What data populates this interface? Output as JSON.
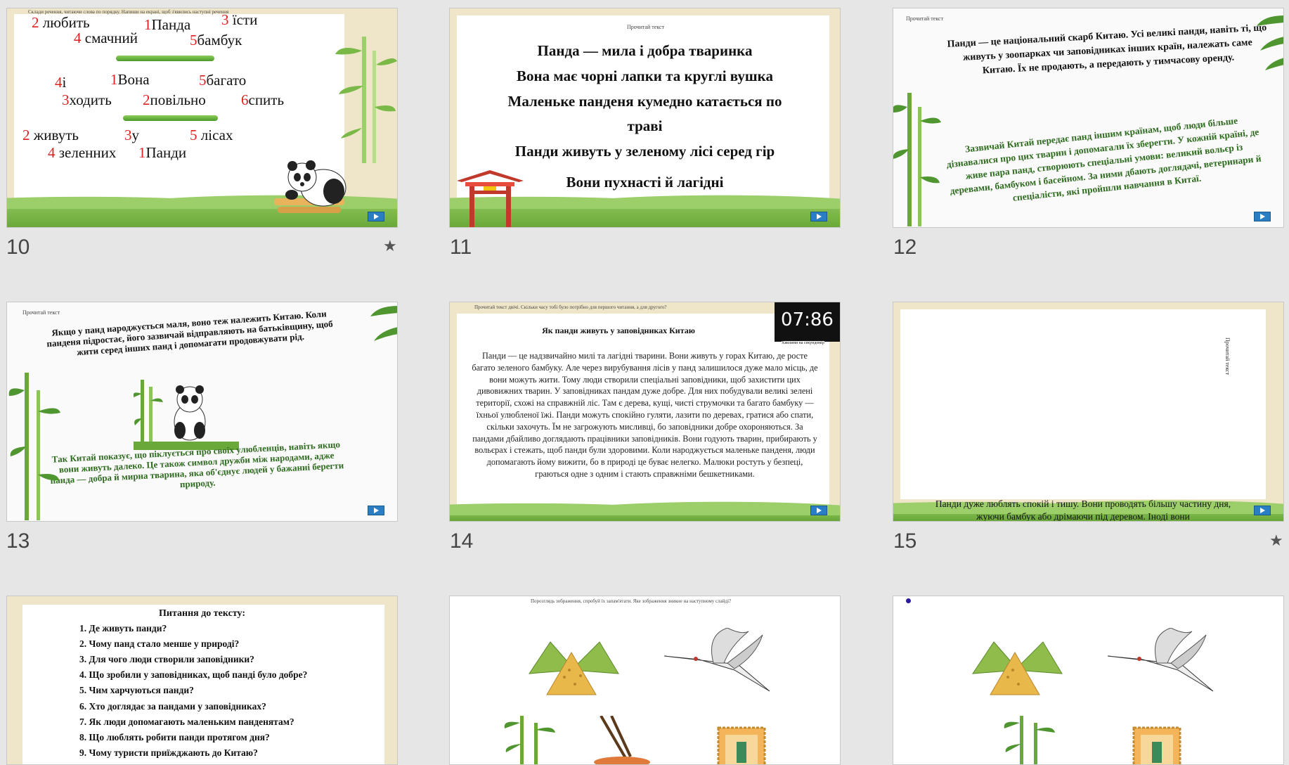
{
  "slides": [
    {
      "num": "10",
      "starred": true,
      "instruction": "Склади речення, читаючи слова по порядку. Напиши на екрані, щоб з'явились наступні речення",
      "words": [
        {
          "n": "2",
          "w": "любить"
        },
        {
          "n": "1",
          "w": "Панда"
        },
        {
          "n": "3",
          "w": "їсти"
        },
        {
          "n": "4",
          "w": "смачний"
        },
        {
          "n": "5",
          "w": "бамбук"
        },
        {
          "n": "4",
          "w": "і"
        },
        {
          "n": "1",
          "w": "Вона"
        },
        {
          "n": "5",
          "w": "багато"
        },
        {
          "n": "3",
          "w": "ходить"
        },
        {
          "n": "2",
          "w": "повільно"
        },
        {
          "n": "6",
          "w": "спить"
        },
        {
          "n": "2",
          "w": "живуть"
        },
        {
          "n": "3",
          "w": "у"
        },
        {
          "n": "5",
          "w": "лісах"
        },
        {
          "n": "4",
          "w": "зеленних"
        },
        {
          "n": "1",
          "w": "Панди"
        }
      ]
    },
    {
      "num": "11",
      "title": "Прочитай текст",
      "lines": [
        "Панда — мила і добра тваринка",
        "Вона має чорні лапки та круглі вушка",
        "Маленьке панденя кумедно катається по",
        "траві",
        "Панди живуть у зеленому лісі серед гір",
        "Вони пухнасті й лагідні"
      ]
    },
    {
      "num": "12",
      "title": "Прочитай текст",
      "p1": "Панди — це національний скарб Китаю. Усі великі панди, навіть ті, що живуть у зоопарках чи заповідниках інших країн, належать саме Китаю. Їх не продають, а передають у тимчасову оренду.",
      "p2": "Зазвичай Китай передає панд іншим країнам, щоб люди більше дізнавалися про цих тварин і допомагали їх зберегти. У кожній країні, де живе пара панд, створюють спеціальні умови: великий вольєр із деревами, бамбуком і басейном. За ними дбають доглядачі, ветеринари й спеціалісти, які пройшли навчання в Китаї."
    },
    {
      "num": "13",
      "title": "Прочитай текст",
      "p1": "Якщо у панд народжується маля, воно теж належить Китаю. Коли панденя підростає, його зазвичай відправляють на батьківщину, щоб жити серед інших панд і допомагати продовжувати рід.",
      "p2": "Так Китай показує, що піклується про своїх улюбленців, навіть якщо вони живуть далеко. Це також символ дружби між народами, адже панда — добра й мирна тварина, яка об'єднує людей у бажанні берегти природу."
    },
    {
      "num": "14",
      "instruction": "Прочитай текст двічі. Скільки часу тобі було потрібно для першого читання, а для другого?",
      "timer": "07:86",
      "timer_label": "Хвилини на секундомір",
      "title": "Як панди живуть у заповідниках Китаю",
      "body": "Панди — це надзвичайно милі та лагідні тварини. Вони живуть у горах Китаю, де росте багато зеленого бамбуку. Але через вирубування лісів у панд залишилося дуже мало місць, де вони можуть жити. Тому люди створили спеціальні заповідники, щоб захистити цих дивовижних тварин. У заповідниках пандам дуже добре. Для них побудували великі зелені території, схожі на справжній ліс. Там є дерева, кущі, чисті струмочки та багато бамбуку — їхньої улюбленої їжі. Панди можуть спокійно гуляти, лазити по деревах, гратися або спати, скільки захочуть. Їм не загрожують мисливці, бо заповідники добре охороняються. За пандами дбайливо доглядають працівники заповідників. Вони годують тварин, прибирають у вольєрах і стежать, щоб панди були здоровими. Коли народжується маленьке панденя, люди допомагають йому вижити, бо в природі це буває нелегко. Малюки ростуть у безпеці, граються одне з одним і стають справжніми бешкетниками."
    },
    {
      "num": "15",
      "starred": true,
      "side_label": "Прочитай текст",
      "text": "Панди дуже люблять спокій і тишу. Вони проводять більшу частину дня, жуючи бамбук або дрімаючи під деревом. Іноді вони"
    },
    {
      "num": "",
      "title": "Питання до тексту:",
      "questions": [
        "1. Де живуть панди?",
        "2. Чому панд стало менше у природі?",
        "3. Для чого люди створили заповідники?",
        "4. Що зробили у заповідниках, щоб панді було добре?",
        "5. Чим харчуються панди?",
        "6. Хто доглядає за пандами у заповідниках?",
        "7. Як люди допомагають маленьким панденятам?",
        "8. Що люблять робити панди протягом дня?",
        "9. Чому туристи приїжджають до Китаю?"
      ]
    },
    {
      "num": "",
      "instruction": "Порозглядь зображення, спробуй їх запам'ятати. Яке зображення зникне на наступному слайді?"
    },
    {
      "num": ""
    }
  ]
}
